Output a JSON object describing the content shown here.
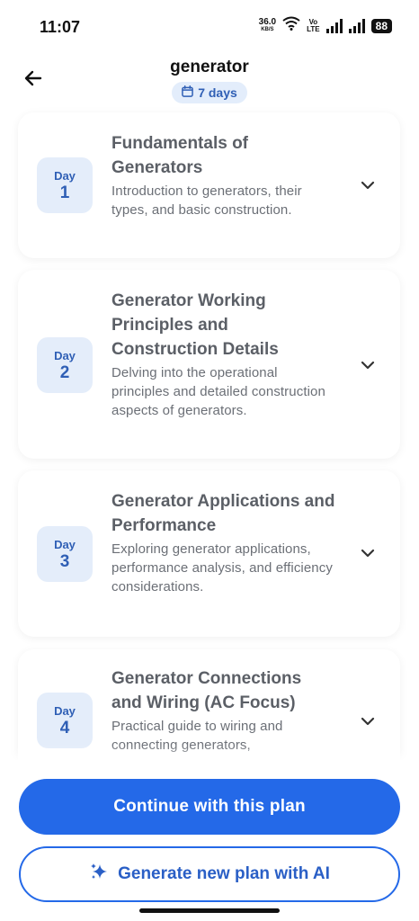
{
  "status_bar": {
    "time": "11:07",
    "net_speed_value": "36.0",
    "net_speed_unit": "KB/S",
    "volte_top": "Vo",
    "volte_bottom": "LTE",
    "battery": "88"
  },
  "header": {
    "title": "generator",
    "duration": "7 days",
    "back_icon": "arrow-left-icon",
    "calendar_icon": "calendar-icon"
  },
  "days": [
    {
      "label": "Day",
      "number": "1",
      "title": "Fundamentals of Generators",
      "description": "Introduction to generators, their types, and basic construction."
    },
    {
      "label": "Day",
      "number": "2",
      "title": "Generator Working Principles and Construction Details",
      "description": "Delving into the operational principles and detailed construction aspects of generators."
    },
    {
      "label": "Day",
      "number": "3",
      "title": "Generator Applications and Performance",
      "description": "Exploring generator applications, performance analysis, and efficiency considerations."
    },
    {
      "label": "Day",
      "number": "4",
      "title": "Generator Connections and Wiring (AC Focus)",
      "description": "Practical guide to wiring and connecting generators,"
    }
  ],
  "actions": {
    "continue_label": "Continue with this plan",
    "generate_label": "Generate new plan with AI",
    "sparkle_icon": "sparkle-icon"
  },
  "colors": {
    "accent": "#2469e8",
    "badge_bg": "#e4edfa",
    "badge_text": "#2f5fb5"
  }
}
